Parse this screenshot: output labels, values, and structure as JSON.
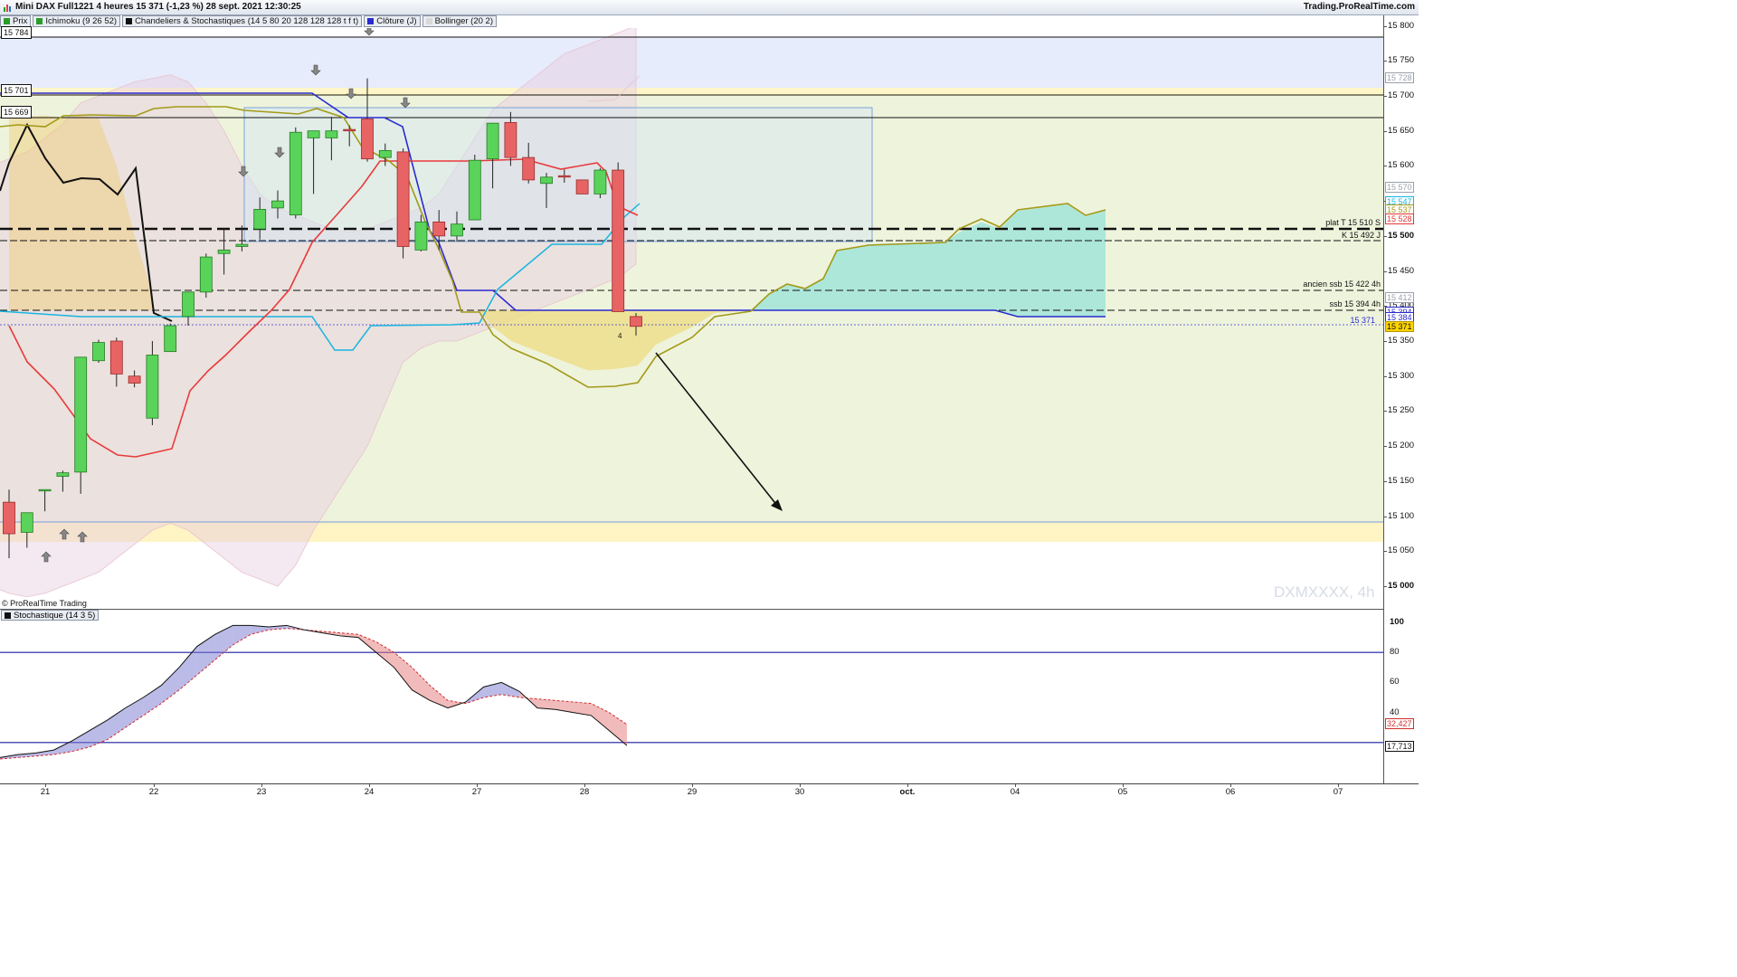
{
  "window": {
    "title": "Mini DAX Full1221 4 heures 15 371 (-1,23 %) 28 sept. 2021 12:30:25",
    "brand": "Trading.ProRealTime.com"
  },
  "legend": [
    {
      "label": "Prix",
      "color": "#2a9d2a"
    },
    {
      "label": "Ichimoku (9 26 52)",
      "color": "#2a9d2a"
    },
    {
      "label": "Chandeliers & Stochastiques (14 5 80 20 128 128 128 t f t)",
      "color": "#111111"
    },
    {
      "label": "Clôture (J)",
      "color": "#2b2bd0"
    },
    {
      "label": "Bollinger (20 2)",
      "color": "#d8d8d8"
    }
  ],
  "tags": {
    "top": "15 784",
    "t15701": "15 701",
    "t15669": "15 669"
  },
  "hlines": {
    "plat": "plat T 15 510 S",
    "k": "K 15 492 J",
    "ancien": "ancien ssb 15 422 4h",
    "ssb": "ssb 15 394 4h",
    "last": "15 371"
  },
  "price_axis": [
    "15 800",
    "15 750",
    "15 700",
    "15 650",
    "15 600",
    "15 550",
    "15 500",
    "15 450",
    "15 400",
    "15 350",
    "15 300",
    "15 250",
    "15 200",
    "15 150",
    "15 100",
    "15 050",
    "15 000"
  ],
  "price_boxes": [
    {
      "text": "15 728",
      "color": "#9aa0aa"
    },
    {
      "text": "15 570",
      "color": "#9aa0aa"
    },
    {
      "text": "15 547",
      "color": "#19b4e0"
    },
    {
      "text": "15 537",
      "color": "#a39a18"
    },
    {
      "text": "15 528",
      "color": "#e03a3a"
    },
    {
      "text": "15 412",
      "color": "#9aa0aa"
    },
    {
      "text": "15 394",
      "color": "#2b2bd0"
    },
    {
      "text": "15 384",
      "color": "#2b2bd0"
    },
    {
      "text": "15 371",
      "color": "#111111"
    }
  ],
  "chart_data": {
    "type": "candlestick",
    "instrument": "Mini DAX Full1221",
    "timeframe": "4 heures",
    "ylim": [
      14985,
      15810
    ],
    "candles": [
      [
        15120,
        15138,
        15040,
        15075
      ],
      [
        15077,
        15102,
        15055,
        15105
      ],
      [
        15137,
        15137,
        15107,
        15138
      ],
      [
        15157,
        15165,
        15135,
        15162
      ],
      [
        15163,
        15178,
        15132,
        15327
      ],
      [
        15322,
        15352,
        15319,
        15348
      ],
      [
        15350,
        15355,
        15285,
        15303
      ],
      [
        15300,
        15308,
        15284,
        15290
      ],
      [
        15240,
        15350,
        15230,
        15330
      ],
      [
        15335,
        15375,
        15338,
        15372
      ],
      [
        15385,
        15408,
        15372,
        15420
      ],
      [
        15420,
        15475,
        15412,
        15470
      ],
      [
        15475,
        15510,
        15445,
        15480
      ],
      [
        15485,
        15515,
        15478,
        15488
      ],
      [
        15510,
        15555,
        15495,
        15538
      ],
      [
        15540,
        15565,
        15525,
        15550
      ],
      [
        15530,
        15655,
        15525,
        15648
      ],
      [
        15640,
        15648,
        15560,
        15650
      ],
      [
        15640,
        15670,
        15608,
        15650
      ],
      [
        15652,
        15658,
        15628,
        15650
      ],
      [
        15667,
        15725,
        15606,
        15610
      ],
      [
        15612,
        15632,
        15600,
        15622
      ],
      [
        15620,
        15625,
        15468,
        15485
      ],
      [
        15480,
        15530,
        15478,
        15520
      ],
      [
        15520,
        15537,
        15480,
        15500
      ],
      [
        15500,
        15535,
        15492,
        15517
      ],
      [
        15523,
        15616,
        15540,
        15608
      ],
      [
        15610,
        15660,
        15568,
        15661
      ],
      [
        15662,
        15677,
        15600,
        15612
      ],
      [
        15612,
        15633,
        15575,
        15580
      ],
      [
        15575,
        15590,
        15540,
        15584
      ],
      [
        15586,
        15595,
        15576,
        15585
      ],
      [
        15580,
        15580,
        15560,
        15560
      ],
      [
        15560,
        15597,
        15554,
        15594
      ],
      [
        15594,
        15605,
        15393,
        15392
      ],
      [
        15385,
        15390,
        15358,
        15371
      ]
    ],
    "tenkan": [
      15350,
      15360,
      15395,
      15460,
      15470,
      15480,
      15490,
      15510,
      15580,
      15612,
      15622,
      15612,
      15612,
      15612
    ],
    "kijun": [
      15582,
      15614,
      15576,
      15560,
      15510,
      15484,
      15476,
      15474,
      15468
    ],
    "chikou": [
      15590,
      15662,
      15605,
      15615,
      15613,
      15585,
      15590,
      15560,
      15592,
      15590,
      15590,
      15480,
      15380,
      15370,
      15382
    ],
    "senkou_span_a": [
      15668,
      15670,
      15672,
      15668,
      15672,
      15668,
      15600,
      15500,
      15418,
      15396,
      15368,
      15342,
      15332,
      15335,
      15362,
      15400,
      15412,
      15432,
      15440,
      15448,
      15480,
      15486,
      15488,
      15490,
      15492,
      15515,
      15520,
      15528,
      15530,
      15535,
      15533,
      15548
    ],
    "senkou_span_b": [
      15394,
      15394,
      15394,
      15394,
      15394,
      15394,
      15394,
      15394,
      15394,
      15394,
      15384
    ],
    "stochastic": {
      "label": "Stochastique (14 3 5)",
      "k_last": 17.713,
      "d_last": 32.427,
      "levels": [
        80,
        20
      ],
      "k": [
        10,
        12,
        13,
        15,
        21,
        28,
        35,
        43,
        50,
        58,
        70,
        84,
        92,
        98,
        98,
        97,
        98,
        95,
        93,
        91,
        90,
        80,
        70,
        55,
        48,
        43,
        47,
        57,
        60,
        54,
        43,
        42,
        40,
        38,
        28,
        18
      ],
      "d": [
        9,
        10,
        11,
        12,
        14,
        17,
        22,
        30,
        38,
        46,
        55,
        65,
        75,
        85,
        92,
        95,
        96,
        95,
        94,
        93,
        92,
        87,
        80,
        70,
        58,
        48,
        46,
        50,
        52,
        50,
        49,
        48,
        47,
        46,
        40,
        32
      ]
    },
    "dates": [
      "21",
      "22",
      "23",
      "24",
      "27",
      "28",
      "29",
      "30",
      "oct.",
      "04",
      "05",
      "06",
      "07"
    ]
  },
  "stoch_axis": [
    "100",
    "80",
    "60",
    "40"
  ],
  "copyright": "© ProRealTime Trading",
  "watermark": "DXMXXXX, 4h"
}
